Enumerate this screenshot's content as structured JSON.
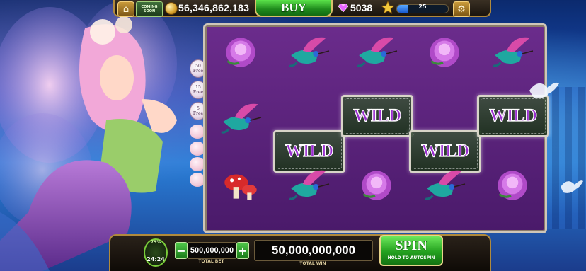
{
  "header": {
    "coming_soon": "COMING SOON",
    "coins": "56,346,862,183",
    "buy_label": "BUY",
    "gems": "5038",
    "level": "25",
    "xp_fraction": 0.22
  },
  "side": {
    "free_options": [
      {
        "count": "50",
        "unit": "Free"
      },
      {
        "count": "15",
        "unit": "Free"
      },
      {
        "count": "5",
        "unit": "Free"
      }
    ]
  },
  "reels": {
    "wild_label": "WILD",
    "grid": [
      [
        "peony",
        "hummingbird",
        "mushroom"
      ],
      [
        "hummingbird",
        "wild",
        "hummingbird"
      ],
      [
        "hummingbird",
        "wild",
        "peony"
      ],
      [
        "peony",
        "wild",
        "hummingbird"
      ],
      [
        "hummingbird",
        "wild",
        "peony"
      ]
    ]
  },
  "footer": {
    "bonus_pct": "75%",
    "bonus_time": "24:24",
    "bet_value": "500,000,000",
    "bet_label": "TOTAL BET",
    "win_value": "50,000,000,000",
    "win_label": "TOTAL WIN",
    "spin_label": "SPIN",
    "spin_sub": "HOLD TO AUTOSPIN"
  },
  "colors": {
    "wild_text": "#9a2dd0",
    "buy_green": "#1f8a1c",
    "gold_trim": "#b08a3c",
    "reel_purple": "#5a2280"
  }
}
